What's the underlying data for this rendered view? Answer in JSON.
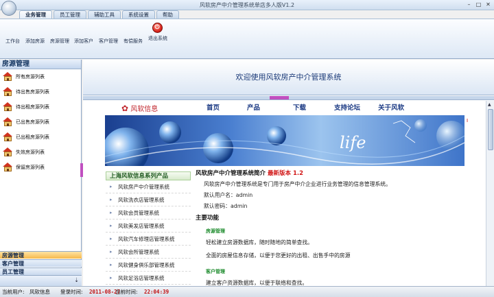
{
  "window": {
    "title": "风软房产中介管理系统单店多人版V1.2"
  },
  "tabs": [
    {
      "label": "业务管理",
      "active": true
    },
    {
      "label": "员工管理"
    },
    {
      "label": "辅助工具"
    },
    {
      "label": "系统设置"
    },
    {
      "label": "帮助"
    }
  ],
  "ribbon": {
    "items": [
      "工作台",
      "添加房源",
      "房源管理",
      "添加客户",
      "客户管理",
      "有偿服务"
    ],
    "exit_label": "退出系统"
  },
  "sidebar": {
    "header": "房源管理",
    "items": [
      "所有房源列表",
      "待出售房源列表",
      "待出租房源列表",
      "已出售房源列表",
      "已出租房源列表",
      "失效房源列表",
      "保留房源列表"
    ],
    "groups": [
      {
        "label": "房源管理",
        "active": true
      },
      {
        "label": "客户管理"
      },
      {
        "label": "员工管理"
      }
    ]
  },
  "main": {
    "welcome": "欢迎使用风软房产中介管理系统",
    "web": {
      "logo": "风软信息",
      "nav": [
        "首页",
        "产品",
        "下载",
        "支持论坛",
        "关于风软"
      ],
      "banner_text": "life",
      "red_mark": "I",
      "products": {
        "header": "上海风软信息系列产品",
        "items": [
          "风软房产中介管理系统",
          "风软洗衣店管理系统",
          "风软会员管理系统",
          "风软美发店管理系统",
          "风软汽车修理店管理系统",
          "风软会所管理系统",
          "风软健身俱乐部管理系统",
          "风软足浴店管理系统"
        ]
      },
      "intro": {
        "title": "风软房产中介管理系统简介",
        "version": "最新版本 1.2",
        "desc": "风软房产中介管理系统是专门用于房产中介企业进行业务管理的信息管理系统。",
        "username": "默认用户名：admin",
        "password": "默认密码：admin",
        "features_title": "主要功能",
        "f1_title": "房源管理",
        "f1_text1": "轻松建立房源数据库，随时随地的简单查找。",
        "f1_text2": "全面的房屋信息存储，以便于您更好的出租、出售手中的房源",
        "f2_title": "客户管理",
        "f2_text1": "建立客户资源数据库，以便于联络和查找。"
      }
    }
  },
  "status": {
    "user_label": "当前用户:",
    "user": "风软信息",
    "login_label": "登录时间:",
    "login_date": "2011-08-27",
    "now_label": "当前时间:",
    "now_time": "22:04:39"
  }
}
